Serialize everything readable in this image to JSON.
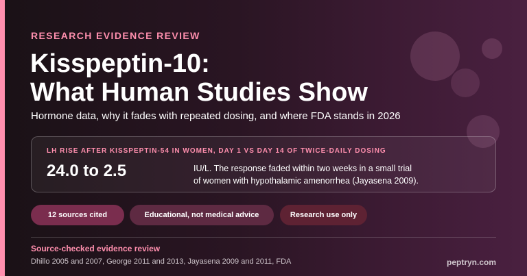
{
  "header": {
    "eyebrow": "RESEARCH EVIDENCE REVIEW",
    "title_line1": "Kisspeptin-10:",
    "title_line2": "What Human Studies Show",
    "subtitle": "Hormone data, why it fades with repeated dosing, and where FDA stands in 2026"
  },
  "stat": {
    "label": "LH RISE AFTER KISSPEPTIN-54 IN WOMEN, DAY 1 VS DAY 14 OF TWICE-DAILY DOSING",
    "value": "24.0 to 2.5",
    "desc_line1": "IU/L. The response faded within two weeks in a small trial",
    "desc_line2": "of women with hypothalamic amenorrhea (Jayasena 2009)."
  },
  "pills": [
    {
      "label": "12 sources cited"
    },
    {
      "label": "Educational, not medical advice"
    },
    {
      "label": "Research use only"
    }
  ],
  "footer": {
    "title": "Source-checked evidence review",
    "sources": "Dhillo 2005 and 2007, George 2011 and 2013, Jayasena 2009 and 2011, FDA",
    "domain": "peptryn.com"
  },
  "colors": {
    "accent": "#ff8fae",
    "background": "#2a1523"
  }
}
